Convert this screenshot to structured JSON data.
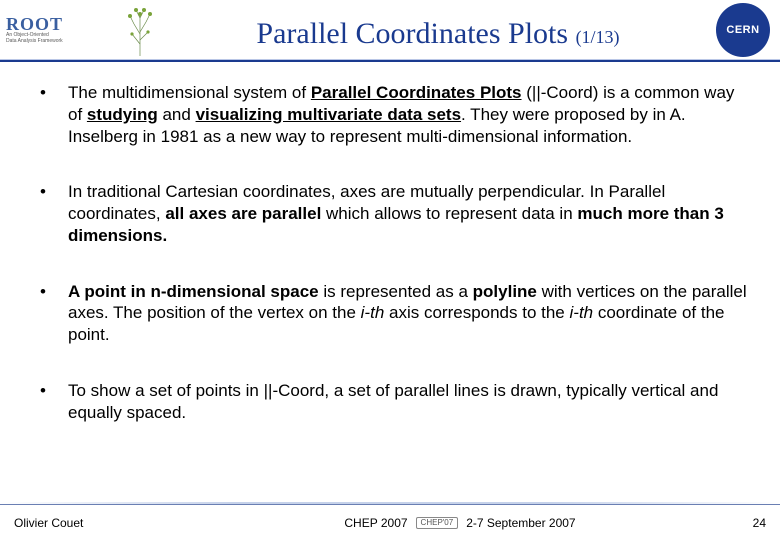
{
  "header": {
    "root_logo_text": "ROOT",
    "root_logo_sub1": "An Object-Oriented",
    "root_logo_sub2": "Data Analysis Framework",
    "title": "Parallel Coordinates Plots",
    "title_count": "(1/13)",
    "cern_label": "CERN"
  },
  "bullets": [
    {
      "segments": [
        {
          "t": "The multidimensional system of ",
          "b": false,
          "u": false,
          "i": false
        },
        {
          "t": "Parallel Coordinates Plots",
          "b": true,
          "u": true,
          "i": false
        },
        {
          "t": " (||-Coord) is a common way of ",
          "b": false,
          "u": false,
          "i": false
        },
        {
          "t": "studying",
          "b": true,
          "u": true,
          "i": false
        },
        {
          "t": " and ",
          "b": false,
          "u": false,
          "i": false
        },
        {
          "t": "visualizing multivariate data sets",
          "b": true,
          "u": true,
          "i": false
        },
        {
          "t": ". They were proposed by in A. Inselberg in 1981 as a new way to represent multi-dimensional information.",
          "b": false,
          "u": false,
          "i": false
        }
      ]
    },
    {
      "segments": [
        {
          "t": "In traditional Cartesian coordinates, axes are mutually perpendicular. In Parallel coordinates, ",
          "b": false,
          "u": false,
          "i": false
        },
        {
          "t": "all axes are parallel",
          "b": true,
          "u": false,
          "i": false
        },
        {
          "t": " which allows to represent data in ",
          "b": false,
          "u": false,
          "i": false
        },
        {
          "t": "much more than 3 dimensions.",
          "b": true,
          "u": false,
          "i": false
        }
      ]
    },
    {
      "segments": [
        {
          "t": "A point in n-dimensional space",
          "b": true,
          "u": false,
          "i": false
        },
        {
          "t": " is represented as a ",
          "b": false,
          "u": false,
          "i": false
        },
        {
          "t": "polyline",
          "b": true,
          "u": false,
          "i": false
        },
        {
          "t": " with vertices on the parallel axes. The position of the vertex on the ",
          "b": false,
          "u": false,
          "i": false
        },
        {
          "t": "i-th",
          "b": false,
          "u": false,
          "i": true
        },
        {
          "t": " axis corresponds to the ",
          "b": false,
          "u": false,
          "i": false
        },
        {
          "t": "i-th",
          "b": false,
          "u": false,
          "i": true
        },
        {
          "t": " coordinate of the point.",
          "b": false,
          "u": false,
          "i": false
        }
      ]
    },
    {
      "segments": [
        {
          "t": "To show a set of points in ||-Coord, a set of parallel lines is drawn, typically vertical and equally spaced.",
          "b": false,
          "u": false,
          "i": false
        }
      ]
    }
  ],
  "footer": {
    "author": "Olivier Couet",
    "event": "CHEP 2007",
    "badge": "CHEP'07",
    "dates": "2-7 September 2007",
    "page": "24"
  }
}
